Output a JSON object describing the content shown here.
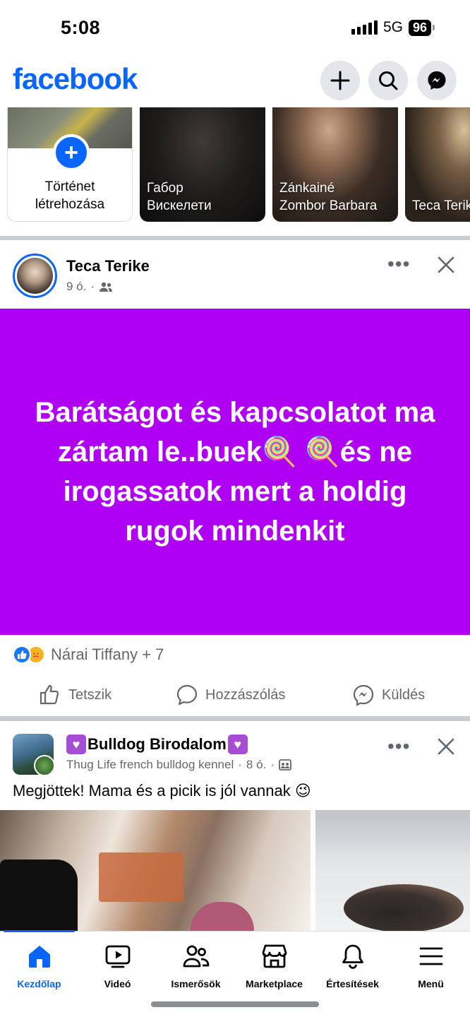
{
  "status_bar": {
    "time": "5:08",
    "network": "5G",
    "battery": "96"
  },
  "header": {
    "logo": "facebook",
    "icons": [
      "plus-icon",
      "search-icon",
      "messenger-icon"
    ]
  },
  "stories": {
    "create_label_line1": "Történet",
    "create_label_line2": "létrehozása",
    "items": [
      {
        "name_line1": "Габор",
        "name_line2": "Вискелети"
      },
      {
        "name_line1": "Zánkainé",
        "name_line2": "Zombor Barbara"
      },
      {
        "name_line1": "",
        "name_line2": "Teca Terike"
      }
    ]
  },
  "post1": {
    "author": "Teca Terike",
    "time": "9 ó.",
    "audience_icon": "friends-icon",
    "text": "Barátságot és kapcsolatot ma zártam le..buek🍭 🍭és ne irogassatok mert a holdig rugok mindenkit",
    "background_color": "#b000f4",
    "reactions_text": "Nárai Tiffany + 7",
    "actions": {
      "like": "Tetszik",
      "comment": "Hozzászólás",
      "send": "Küldés"
    }
  },
  "post2": {
    "author": "Bulldog Birodalom",
    "group": "Thug Life french bulldog kennel",
    "time": "8 ó.",
    "text": "Megjöttek! Mama és a picik is jól vannak 😉"
  },
  "tabbar": {
    "active": "home",
    "tabs": [
      {
        "id": "home",
        "label": "Kezdőlap",
        "icon": "home-icon"
      },
      {
        "id": "video",
        "label": "Videó",
        "icon": "video-icon"
      },
      {
        "id": "friends",
        "label": "Ismerősök",
        "icon": "friends-icon"
      },
      {
        "id": "marketplace",
        "label": "Marketplace",
        "icon": "marketplace-icon"
      },
      {
        "id": "notifications",
        "label": "Értesítések",
        "icon": "bell-icon"
      },
      {
        "id": "menu",
        "label": "Menü",
        "icon": "hamburger-icon"
      }
    ]
  },
  "colors": {
    "accent": "#0866ff",
    "secondary_text": "#65676b",
    "divider": "#c9ccd1"
  }
}
